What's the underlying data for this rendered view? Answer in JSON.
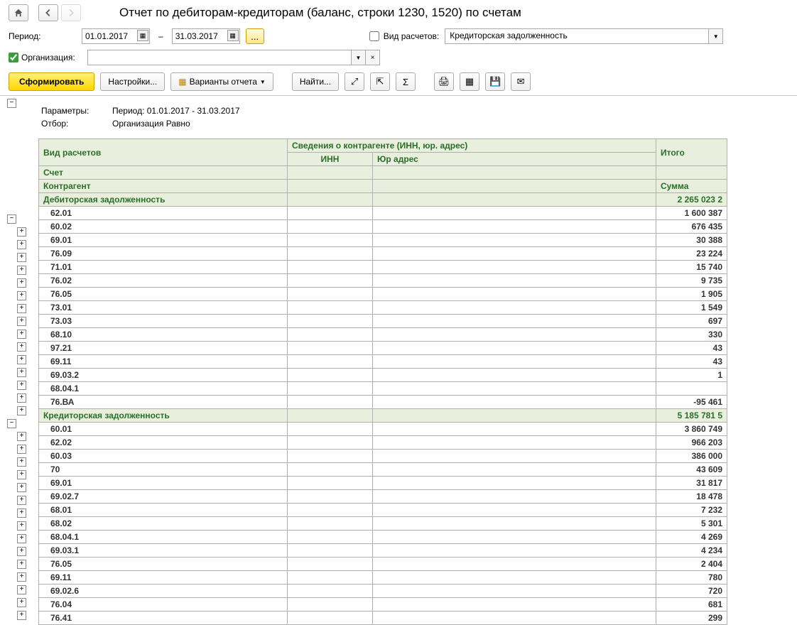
{
  "title": "Отчет по дебиторам-кредиторам (баланс, строки 1230, 1520)  по счетам",
  "labels": {
    "period": "Период:",
    "org": "Организация:",
    "calc_type": "Вид расчетов:",
    "sep": "–"
  },
  "filters": {
    "date_from": "01.01.2017",
    "date_to": "31.03.2017",
    "org_checked": true,
    "org_value": "",
    "calc_type_checked": false,
    "calc_type_value": "Кредиторская задолженность"
  },
  "toolbar": {
    "form": "Сформировать",
    "settings": "Настройки...",
    "variants": "Варианты отчета",
    "find": "Найти..."
  },
  "params": {
    "label1": "Параметры:",
    "value1": "Период: 01.01.2017 - 31.03.2017",
    "label2": "Отбор:",
    "value2": "Организация Равно "
  },
  "headers": {
    "vid": "Вид расчетов",
    "sved": "Сведения о контрагенте (ИНН, юр. адрес)",
    "itogo": "Итого",
    "inn": "ИНН",
    "addr": "Юр адрес",
    "account": "Счет",
    "contragent": "Контрагент",
    "sum": "Сумма"
  },
  "groups": [
    {
      "name": "Дебиторская задолженность",
      "total": "2 265 023 2",
      "rows": [
        {
          "acct": "62.01",
          "val": "1 600 387"
        },
        {
          "acct": "60.02",
          "val": "676 435"
        },
        {
          "acct": "69.01",
          "val": "30 388"
        },
        {
          "acct": "76.09",
          "val": "23 224"
        },
        {
          "acct": "71.01",
          "val": "15 740"
        },
        {
          "acct": "76.02",
          "val": "9 735"
        },
        {
          "acct": "76.05",
          "val": "1 905"
        },
        {
          "acct": "73.01",
          "val": "1 549"
        },
        {
          "acct": "73.03",
          "val": "697"
        },
        {
          "acct": "68.10",
          "val": "330"
        },
        {
          "acct": "97.21",
          "val": "43"
        },
        {
          "acct": "69.11",
          "val": "43"
        },
        {
          "acct": "69.03.2",
          "val": "1"
        },
        {
          "acct": "68.04.1",
          "val": ""
        },
        {
          "acct": "76.ВА",
          "val": "-95 461"
        }
      ]
    },
    {
      "name": "Кредиторская задолженность",
      "total": "5 185 781 5",
      "rows": [
        {
          "acct": "60.01",
          "val": "3 860 749"
        },
        {
          "acct": "62.02",
          "val": "966 203"
        },
        {
          "acct": "60.03",
          "val": "386 000"
        },
        {
          "acct": "70",
          "val": "43 609"
        },
        {
          "acct": "69.01",
          "val": "31 817"
        },
        {
          "acct": "69.02.7",
          "val": "18 478"
        },
        {
          "acct": "68.01",
          "val": "7 232"
        },
        {
          "acct": "68.02",
          "val": "5 301"
        },
        {
          "acct": "68.04.1",
          "val": "4 269"
        },
        {
          "acct": "69.03.1",
          "val": "4 234"
        },
        {
          "acct": "76.05",
          "val": "2 404"
        },
        {
          "acct": "69.11",
          "val": "780"
        },
        {
          "acct": "69.02.6",
          "val": "720"
        },
        {
          "acct": "76.04",
          "val": "681"
        },
        {
          "acct": "76.41",
          "val": "299"
        }
      ]
    }
  ]
}
